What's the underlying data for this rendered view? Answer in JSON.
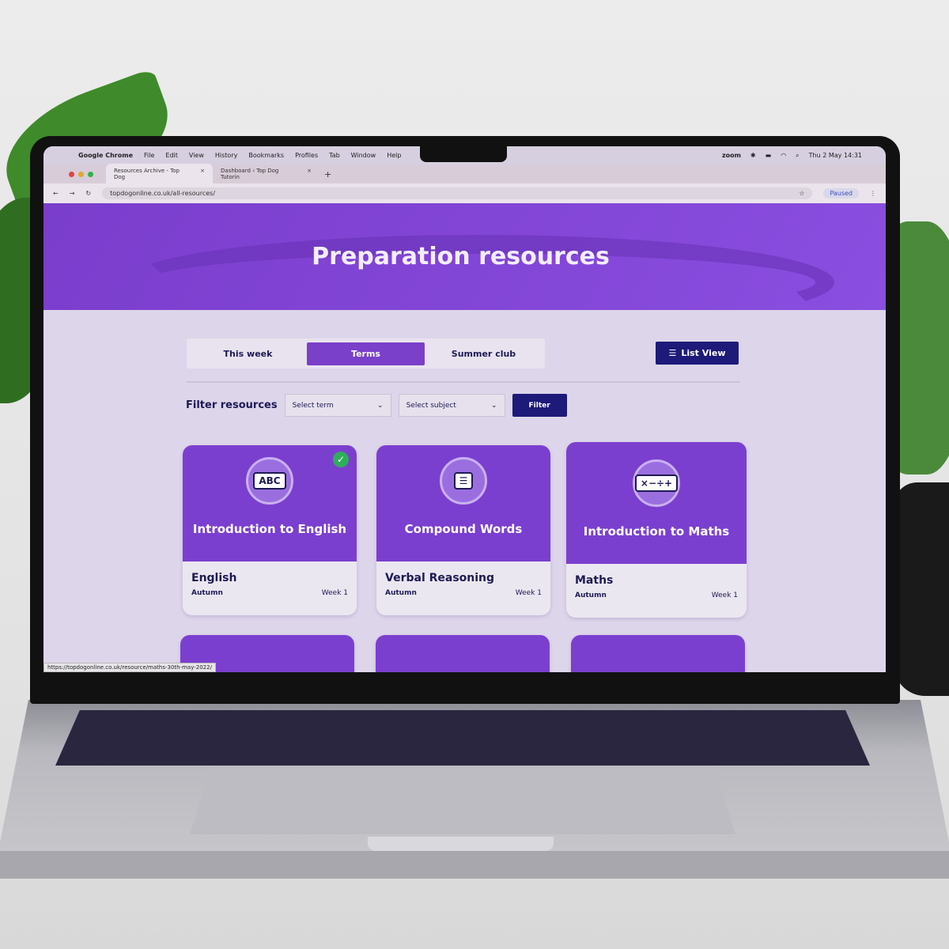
{
  "menubar": {
    "app": "Google Chrome",
    "items": [
      "File",
      "Edit",
      "View",
      "History",
      "Bookmarks",
      "Profiles",
      "Tab",
      "Window",
      "Help"
    ],
    "zoom": "zoom",
    "datetime": "Thu 2 May  14:31"
  },
  "tabs": [
    {
      "title": "Resources Archive - Top Dog"
    },
    {
      "title": "Dashboard ‹ Top Dog Tutorin"
    }
  ],
  "address": {
    "url": "topdogonline.co.uk/all-resources/",
    "profile": "Paused"
  },
  "hero": {
    "title": "Preparation resources"
  },
  "view_tabs": [
    {
      "label": "This week"
    },
    {
      "label": "Terms",
      "selected": true
    },
    {
      "label": "Summer club"
    }
  ],
  "list_view": "List View",
  "filter": {
    "label": "Filter resources",
    "term_placeholder": "Select term",
    "subject_placeholder": "Select subject",
    "button": "Filter"
  },
  "cards": [
    {
      "title": "Introduction to English",
      "subject": "English",
      "term": "Autumn",
      "week": "Week 1",
      "icon": "ABC",
      "completed": true
    },
    {
      "title": "Compound Words",
      "subject": "Verbal Reasoning",
      "term": "Autumn",
      "week": "Week 1",
      "icon": "☰"
    },
    {
      "title": "Introduction to Maths",
      "subject": "Maths",
      "term": "Autumn",
      "week": "Week 1",
      "icon": "×−÷+"
    }
  ],
  "status_url": "https://topdogonline.co.uk/resource/maths-30th-may-2022/",
  "colors": {
    "brand_purple": "#7b3fcf",
    "navy": "#1d1a7a",
    "complete_green": "#2fae5a"
  }
}
